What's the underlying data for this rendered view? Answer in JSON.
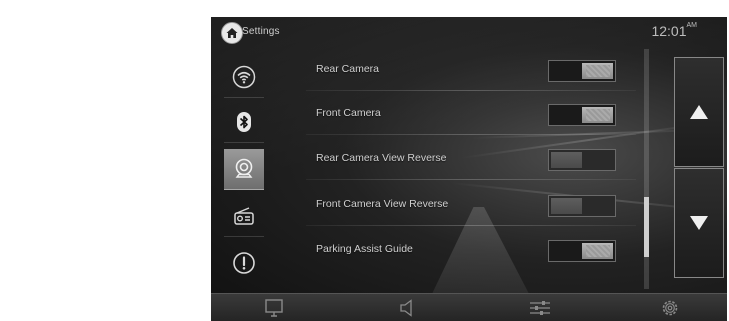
{
  "header": {
    "title": "Settings",
    "clock_time": "12:01",
    "clock_ampm": "AM",
    "home_icon": "home-icon"
  },
  "sidebar": {
    "items": [
      {
        "name": "wifi",
        "icon": "wifi-icon",
        "active": false
      },
      {
        "name": "bluetooth",
        "icon": "bluetooth-icon",
        "active": false
      },
      {
        "name": "camera",
        "icon": "camera-icon",
        "active": true
      },
      {
        "name": "radio",
        "icon": "radio-icon",
        "active": false
      },
      {
        "name": "info",
        "icon": "exclamation-icon",
        "active": false
      }
    ]
  },
  "settings": {
    "rows": [
      {
        "label": "Rear Camera",
        "state": "on"
      },
      {
        "label": "Front Camera",
        "state": "on"
      },
      {
        "label": "Rear Camera View Reverse",
        "state": "off"
      },
      {
        "label": "Front Camera View Reverse",
        "state": "off"
      },
      {
        "label": "Parking Assist Guide",
        "state": "on"
      }
    ]
  },
  "scrollbar": {
    "position_fraction": 0.82,
    "thumb_fraction": 0.25
  },
  "navigation": {
    "up_icon": "up-arrow-icon",
    "down_icon": "down-arrow-icon"
  },
  "bottom_bar": {
    "items": [
      "monitor-icon",
      "speaker-icon",
      "sliders-icon",
      "gear-icon"
    ]
  },
  "colors": {
    "accent": "#cfcfcf",
    "background": "#1a1a1a",
    "toggle_on": "#a8a8a8",
    "toggle_off": "#4a4a4a"
  }
}
